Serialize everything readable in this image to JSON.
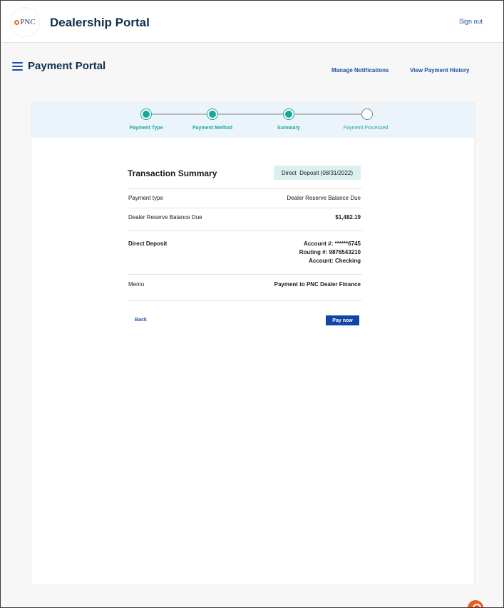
{
  "header": {
    "logo_text": "PNC",
    "app_title": "Dealership Portal",
    "sign_out": "Sign out"
  },
  "page": {
    "title": "Payment Portal",
    "links": {
      "manage_notifications": "Manage Notifications",
      "view_payment_history": "View Payment History"
    }
  },
  "stepper": {
    "steps": [
      {
        "label": "Payment Type",
        "status": "complete"
      },
      {
        "label": "Payment Method",
        "status": "complete"
      },
      {
        "label": "Summary",
        "status": "complete"
      },
      {
        "label": "Payment Processed",
        "status": "pending"
      }
    ]
  },
  "summary": {
    "title": "Transaction Summary",
    "badge": "Direct  Deposit (08/31/2022)",
    "rows": [
      {
        "label": "Payment type",
        "value": "Dealer Reserve Balance Due"
      },
      {
        "label": "Dealer Reserve Balance Due",
        "value": "$1,482.19"
      },
      {
        "label": "Direct Deposit",
        "lines": [
          "Account #: ******6745",
          "Routing #: 9876543210",
          "Account: Checking"
        ]
      },
      {
        "label": "Memo",
        "value": "Payment to PNC Dealer Finance"
      }
    ]
  },
  "actions": {
    "back": "Back",
    "pay_now": "Pay now"
  },
  "colors": {
    "brand_navy": "#10304f",
    "link_blue": "#1e50a8",
    "teal": "#1aa79b",
    "button_blue": "#1245a8",
    "pnc_orange": "#ef6a22"
  },
  "icons": [
    "pnc-logo-icon",
    "hamburger-menu-icon",
    "chat-icon"
  ]
}
